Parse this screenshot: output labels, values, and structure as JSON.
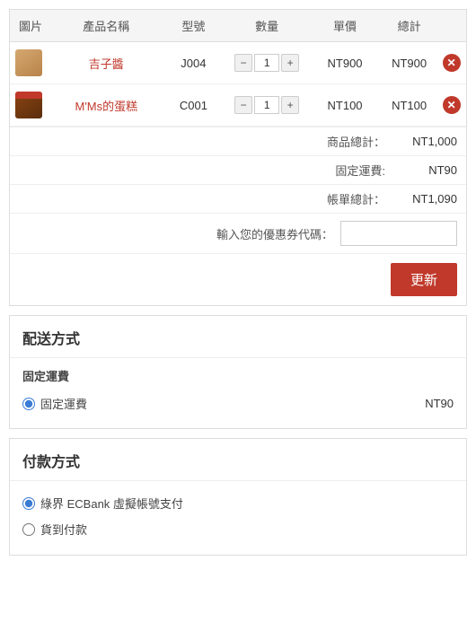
{
  "cart": {
    "columns": {
      "image": "圖片",
      "name": "產品名稱",
      "model": "型號",
      "quantity": "數量",
      "unit_price": "單價",
      "total": "總計"
    },
    "items": [
      {
        "id": "item-1",
        "image_alt": "吉子醬",
        "name": "吉子醬",
        "model": "J004",
        "quantity": 1,
        "unit_price": "NT900",
        "total": "NT900"
      },
      {
        "id": "item-2",
        "image_alt": "M'Ms的蛋糕",
        "name": "M'Ms的蛋糕",
        "model": "C001",
        "quantity": 1,
        "unit_price": "NT100",
        "total": "NT100"
      }
    ],
    "summary": {
      "subtotal_label": "商品總計：",
      "subtotal_value": "NT1,000",
      "shipping_label": "固定運費:",
      "shipping_value": "NT90",
      "total_label": "帳單總計：",
      "total_value": "NT1,090"
    },
    "coupon": {
      "label": "輸入您的優惠券代碼：",
      "placeholder": ""
    },
    "update_button": "更新"
  },
  "shipping": {
    "section_title": "配送方式",
    "option_title": "固定運費",
    "option_label": "固定運費",
    "option_price": "NT90"
  },
  "payment": {
    "section_title": "付款方式",
    "options": [
      {
        "id": "ecbank",
        "label": "綠界 ECBank 虛擬帳號支付",
        "selected": true
      },
      {
        "id": "cod",
        "label": "貨到付款",
        "selected": false
      }
    ]
  }
}
